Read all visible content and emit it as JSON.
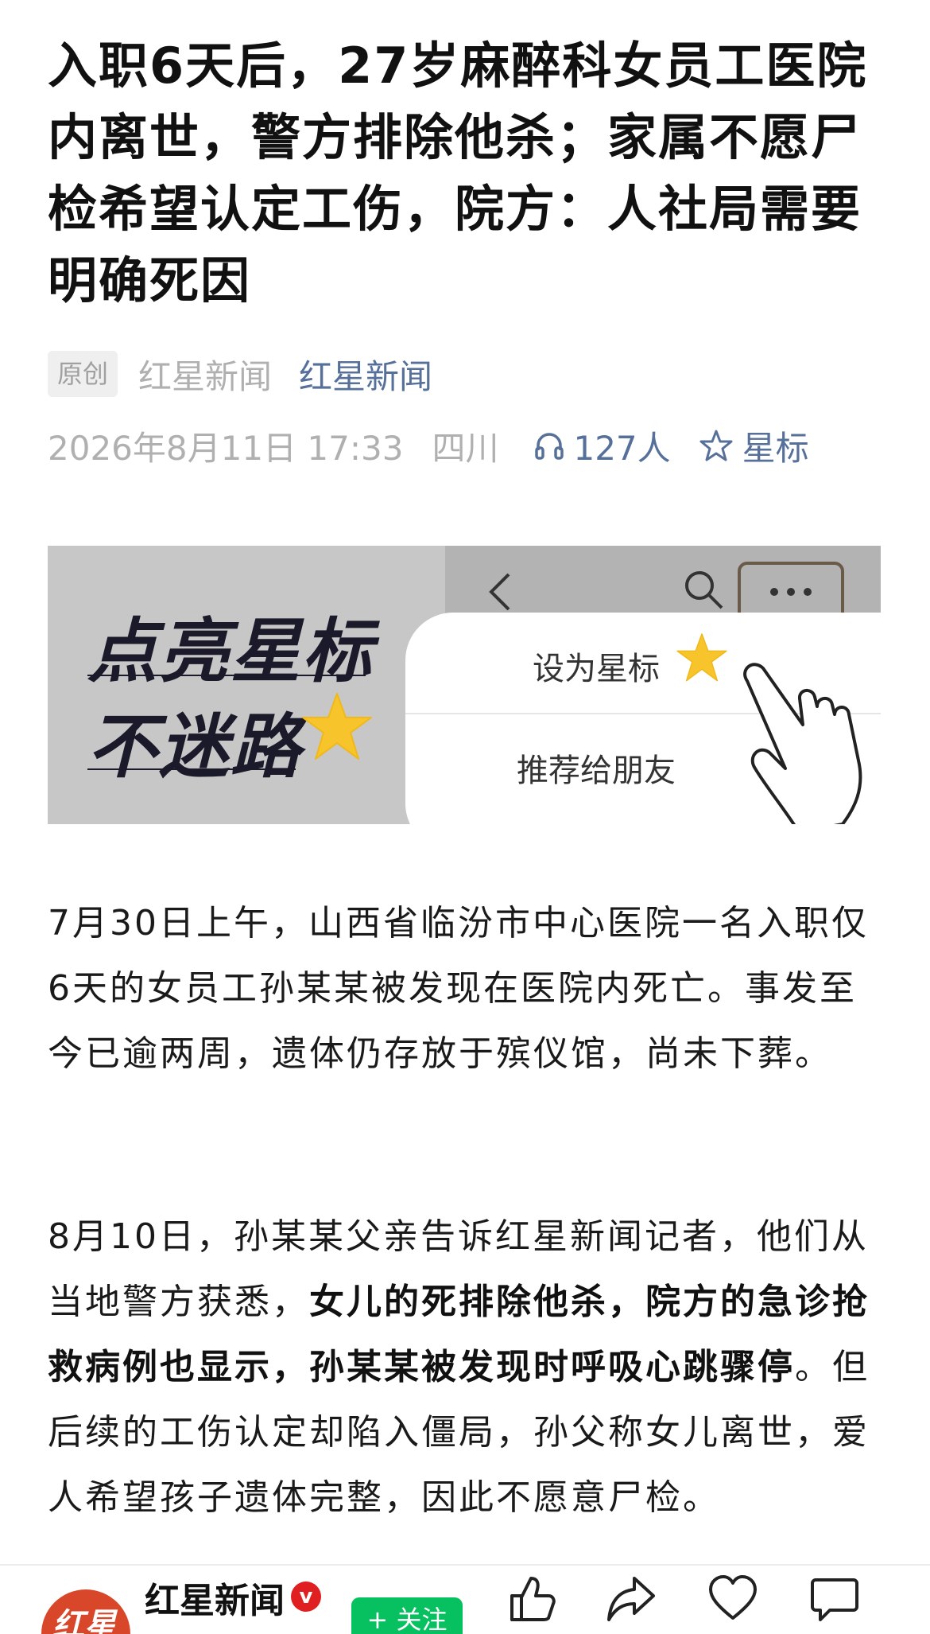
{
  "article": {
    "title": "入职6天后，27岁麻醉科女员工医院内离世，警方排除他杀；家属不愿尸检希望认定工伤，院方：人社局需要明确死因",
    "original_badge": "原创",
    "author": "红星新闻",
    "account_link": "红星新闻",
    "date": "2026年8月11日 17:33",
    "region": "四川",
    "listen_count": "127人",
    "star_label": "星标"
  },
  "banner": {
    "slogan_line1": "点亮星标",
    "slogan_line2": "不迷路",
    "menu_item1": "设为星标",
    "menu_item2": "推荐给朋友"
  },
  "body": {
    "paragraph1": "7月30日上午，山西省临汾市中心医院一名入职仅6天的女员工孙某某被发现在医院内死亡。事发至今已逾两周，遗体仍存放于殡仪馆，尚未下葬。",
    "paragraph2_a": "8月10日，孙某某父亲告诉红星新闻记者，他们从当地警方获悉，",
    "paragraph2_bold": "女儿的死排除他杀，院方的急诊抢救病例也显示，孙某某被发现时呼吸心跳骤停",
    "paragraph2_b": "。但后续的工伤认定却陷入僵局，孙父称女儿离世，爱人希望孩子遗体完整，因此不愿意尸检。"
  },
  "bottom_bar": {
    "account_name": "红星新闻",
    "avatar_text": "红星",
    "verified_mark": "v",
    "follow_label": "+ 关注"
  },
  "colors": {
    "link": "#56709a",
    "meta_gray": "#b0b0b0",
    "follow_green": "#07c160",
    "verified_red": "#e02020",
    "star_yellow": "#f7c52b"
  },
  "icons": [
    "back-icon",
    "search-icon",
    "more-icon",
    "star-icon",
    "pointing-hand-icon",
    "headphones-icon",
    "star-outline-icon",
    "thumbs-up-icon",
    "share-icon",
    "heart-icon",
    "comment-icon"
  ]
}
